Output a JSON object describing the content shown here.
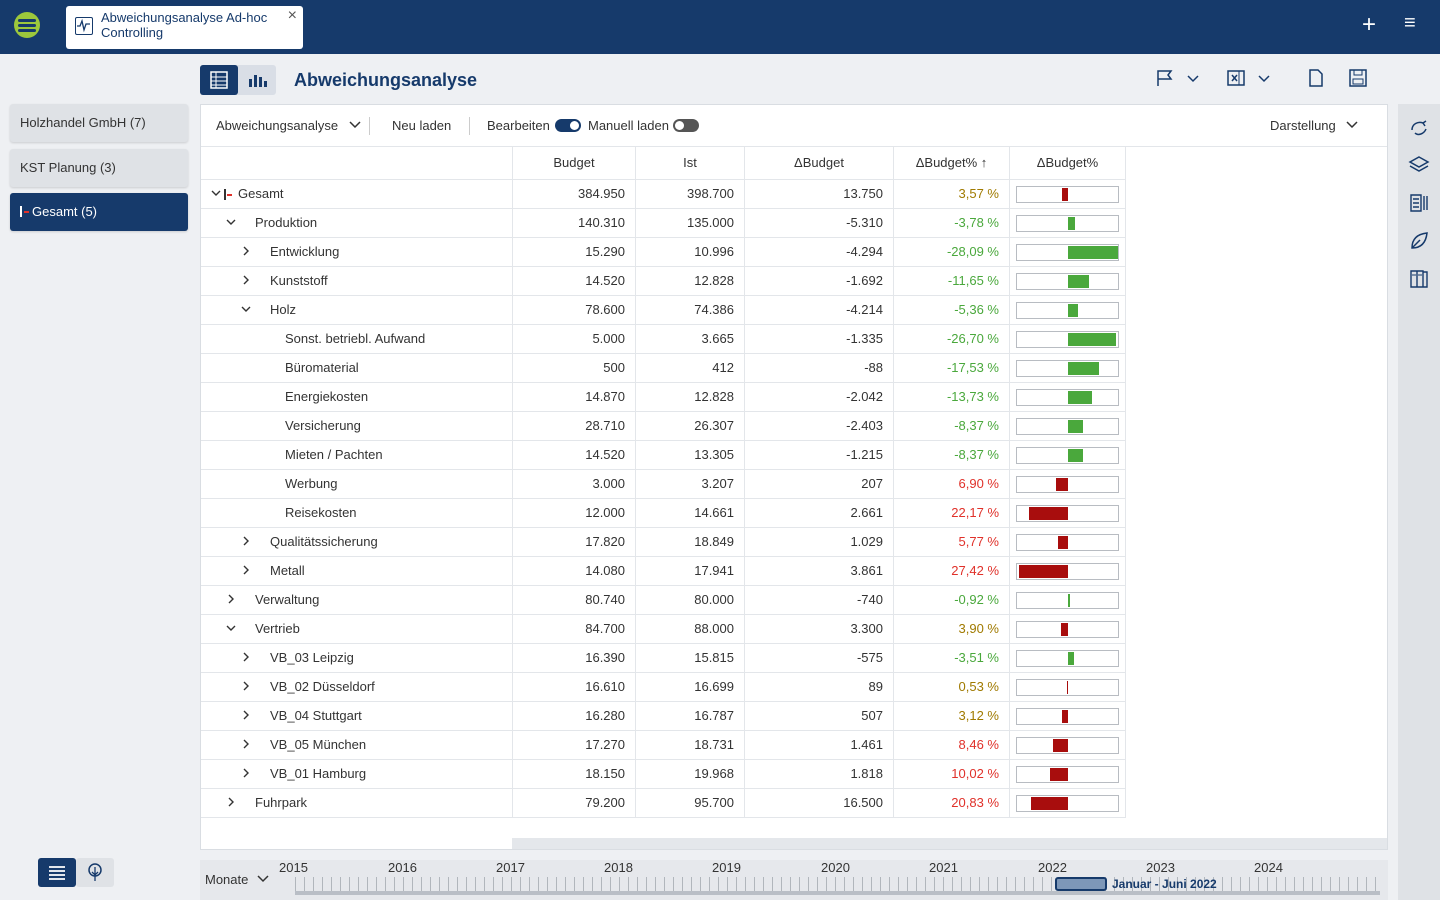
{
  "app": {
    "tab_title": "Abweichungsanalyse Ad-hoc Controlling",
    "tab_close": "×",
    "plus": "+",
    "menu": "≡"
  },
  "page": {
    "title": "Abweichungsanalyse"
  },
  "nav": {
    "items": [
      {
        "label": "Holzhandel GmbH (7)",
        "active": false
      },
      {
        "label": "KST Planung (3)",
        "active": false
      },
      {
        "label": "Gesamt (5)",
        "active": true
      }
    ]
  },
  "toolbar": {
    "view_select": "Abweichungsanalyse",
    "reload": "Neu laden",
    "edit_label": "Bearbeiten",
    "edit_on": true,
    "manual_label": "Manuell laden",
    "manual_on": false,
    "display_label": "Darstellung"
  },
  "columns": {
    "budget": "Budget",
    "ist": "Ist",
    "dbudget": "ΔBudget",
    "dbudget_pct": "ΔBudget% ↑",
    "dbudget_pct_bar": "ΔBudget%"
  },
  "rows": [
    {
      "name": "Gesamt",
      "level": 0,
      "toggle": "expanded",
      "marker": true,
      "budget": "384.950",
      "ist": "398.700",
      "delta": "13.750",
      "pct": "3,57 %",
      "pct_value": 3.57
    },
    {
      "name": "Produktion",
      "level": 1,
      "toggle": "expanded",
      "budget": "140.310",
      "ist": "135.000",
      "delta": "-5.310",
      "pct": "-3,78 %",
      "pct_value": -3.78
    },
    {
      "name": "Entwicklung",
      "level": 2,
      "toggle": "collapsed",
      "budget": "15.290",
      "ist": "10.996",
      "delta": "-4.294",
      "pct": "-28,09 %",
      "pct_value": -28.09
    },
    {
      "name": "Kunststoff",
      "level": 2,
      "toggle": "collapsed",
      "budget": "14.520",
      "ist": "12.828",
      "delta": "-1.692",
      "pct": "-11,65 %",
      "pct_value": -11.65
    },
    {
      "name": "Holz",
      "level": 2,
      "toggle": "expanded",
      "budget": "78.600",
      "ist": "74.386",
      "delta": "-4.214",
      "pct": "-5,36 %",
      "pct_value": -5.36
    },
    {
      "name": "Sonst. betriebl. Aufwand",
      "level": 3,
      "toggle": "none",
      "budget": "5.000",
      "ist": "3.665",
      "delta": "-1.335",
      "pct": "-26,70 %",
      "pct_value": -26.7
    },
    {
      "name": "Büromaterial",
      "level": 3,
      "toggle": "none",
      "budget": "500",
      "ist": "412",
      "delta": "-88",
      "pct": "-17,53 %",
      "pct_value": -17.53
    },
    {
      "name": "Energiekosten",
      "level": 3,
      "toggle": "none",
      "budget": "14.870",
      "ist": "12.828",
      "delta": "-2.042",
      "pct": "-13,73 %",
      "pct_value": -13.73
    },
    {
      "name": "Versicherung",
      "level": 3,
      "toggle": "none",
      "budget": "28.710",
      "ist": "26.307",
      "delta": "-2.403",
      "pct": "-8,37 %",
      "pct_value": -8.37
    },
    {
      "name": "Mieten / Pachten",
      "level": 3,
      "toggle": "none",
      "budget": "14.520",
      "ist": "13.305",
      "delta": "-1.215",
      "pct": "-8,37 %",
      "pct_value": -8.37
    },
    {
      "name": "Werbung",
      "level": 3,
      "toggle": "none",
      "budget": "3.000",
      "ist": "3.207",
      "delta": "207",
      "pct": "6,90 %",
      "pct_value": 6.9
    },
    {
      "name": "Reisekosten",
      "level": 3,
      "toggle": "none",
      "budget": "12.000",
      "ist": "14.661",
      "delta": "2.661",
      "pct": "22,17 %",
      "pct_value": 22.17
    },
    {
      "name": "Qualitätssicherung",
      "level": 2,
      "toggle": "collapsed",
      "budget": "17.820",
      "ist": "18.849",
      "delta": "1.029",
      "pct": "5,77 %",
      "pct_value": 5.77
    },
    {
      "name": "Metall",
      "level": 2,
      "toggle": "collapsed",
      "budget": "14.080",
      "ist": "17.941",
      "delta": "3.861",
      "pct": "27,42 %",
      "pct_value": 27.42
    },
    {
      "name": "Verwaltung",
      "level": 1,
      "toggle": "collapsed",
      "budget": "80.740",
      "ist": "80.000",
      "delta": "-740",
      "pct": "-0,92 %",
      "pct_value": -0.92
    },
    {
      "name": "Vertrieb",
      "level": 1,
      "toggle": "expanded",
      "budget": "84.700",
      "ist": "88.000",
      "delta": "3.300",
      "pct": "3,90 %",
      "pct_value": 3.9
    },
    {
      "name": "VB_03 Leipzig",
      "level": 2,
      "toggle": "collapsed",
      "budget": "16.390",
      "ist": "15.815",
      "delta": "-575",
      "pct": "-3,51 %",
      "pct_value": -3.51
    },
    {
      "name": "VB_02 Düsseldorf",
      "level": 2,
      "toggle": "collapsed",
      "budget": "16.610",
      "ist": "16.699",
      "delta": "89",
      "pct": "0,53 %",
      "pct_value": 0.53
    },
    {
      "name": "VB_04 Stuttgart",
      "level": 2,
      "toggle": "collapsed",
      "budget": "16.280",
      "ist": "16.787",
      "delta": "507",
      "pct": "3,12 %",
      "pct_value": 3.12
    },
    {
      "name": "VB_05 München",
      "level": 2,
      "toggle": "collapsed",
      "budget": "17.270",
      "ist": "18.731",
      "delta": "1.461",
      "pct": "8,46 %",
      "pct_value": 8.46
    },
    {
      "name": "VB_01 Hamburg",
      "level": 2,
      "toggle": "collapsed",
      "budget": "18.150",
      "ist": "19.968",
      "delta": "1.818",
      "pct": "10,02 %",
      "pct_value": 10.02
    },
    {
      "name": "Fuhrpark",
      "level": 1,
      "toggle": "collapsed",
      "budget": "79.200",
      "ist": "95.700",
      "delta": "16.500",
      "pct": "20,83 %",
      "pct_value": 20.83
    }
  ],
  "timeline": {
    "granularity": "Monate",
    "years": [
      "2015",
      "2016",
      "2017",
      "2018",
      "2019",
      "2020",
      "2021",
      "2022",
      "2023",
      "2024"
    ],
    "selection": "Januar - Juni 2022"
  },
  "colors": {
    "primary": "#163a6b",
    "negative_bar": "#a80d0d",
    "positive_bar": "#4aa83c",
    "pct_over": "#e0312a",
    "pct_under": "#4aa83c",
    "pct_small_over": "#a07a00",
    "logo": "#9cc83c"
  },
  "icons": {
    "toggle_expanded": "⌄",
    "toggle_collapsed": "›"
  }
}
